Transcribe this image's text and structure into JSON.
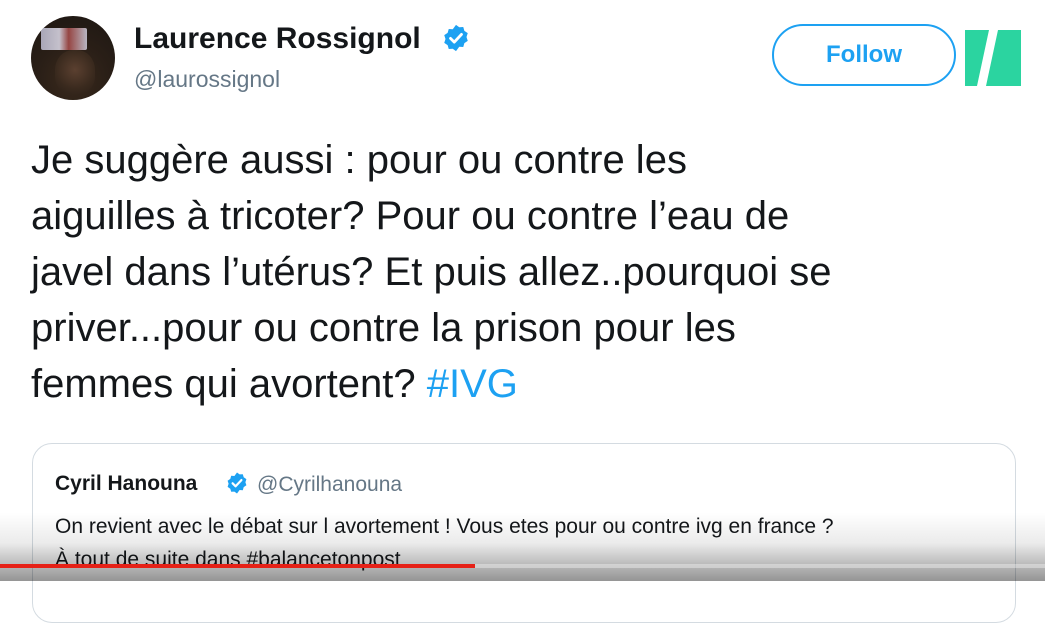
{
  "tweet": {
    "author": {
      "name": "Laurence Rossignol",
      "handle": "@laurossignol",
      "verified": true
    },
    "follow_label": "Follow",
    "text_lines": [
      "Je suggère aussi : pour ou contre les",
      "aiguilles à tricoter? Pour ou contre l’eau de",
      "javel dans l’utérus? Et puis allez..pourquoi se",
      "priver...pour ou contre la prison pour les",
      "femmes qui avortent? "
    ],
    "hashtag": "#IVG"
  },
  "quoted_tweet": {
    "author_name": "Cyril Hanouna",
    "author_handle": "@Cyrilhanouna",
    "verified": true,
    "text_lines": [
      "On revient avec le débat sur l avortement ! Vous etes pour ou contre ivg en france ?",
      "À tout de suite dans #balancetonpost"
    ]
  },
  "video_player": {
    "progress": 0.455
  },
  "colors": {
    "accent": "#1da1f2",
    "brand_logo": "#2bd4a0",
    "progress": "#e62117",
    "muted_text": "#657786"
  },
  "icons": {
    "verified": "verified-badge-icon",
    "logo": "huffpost-logo-icon"
  }
}
